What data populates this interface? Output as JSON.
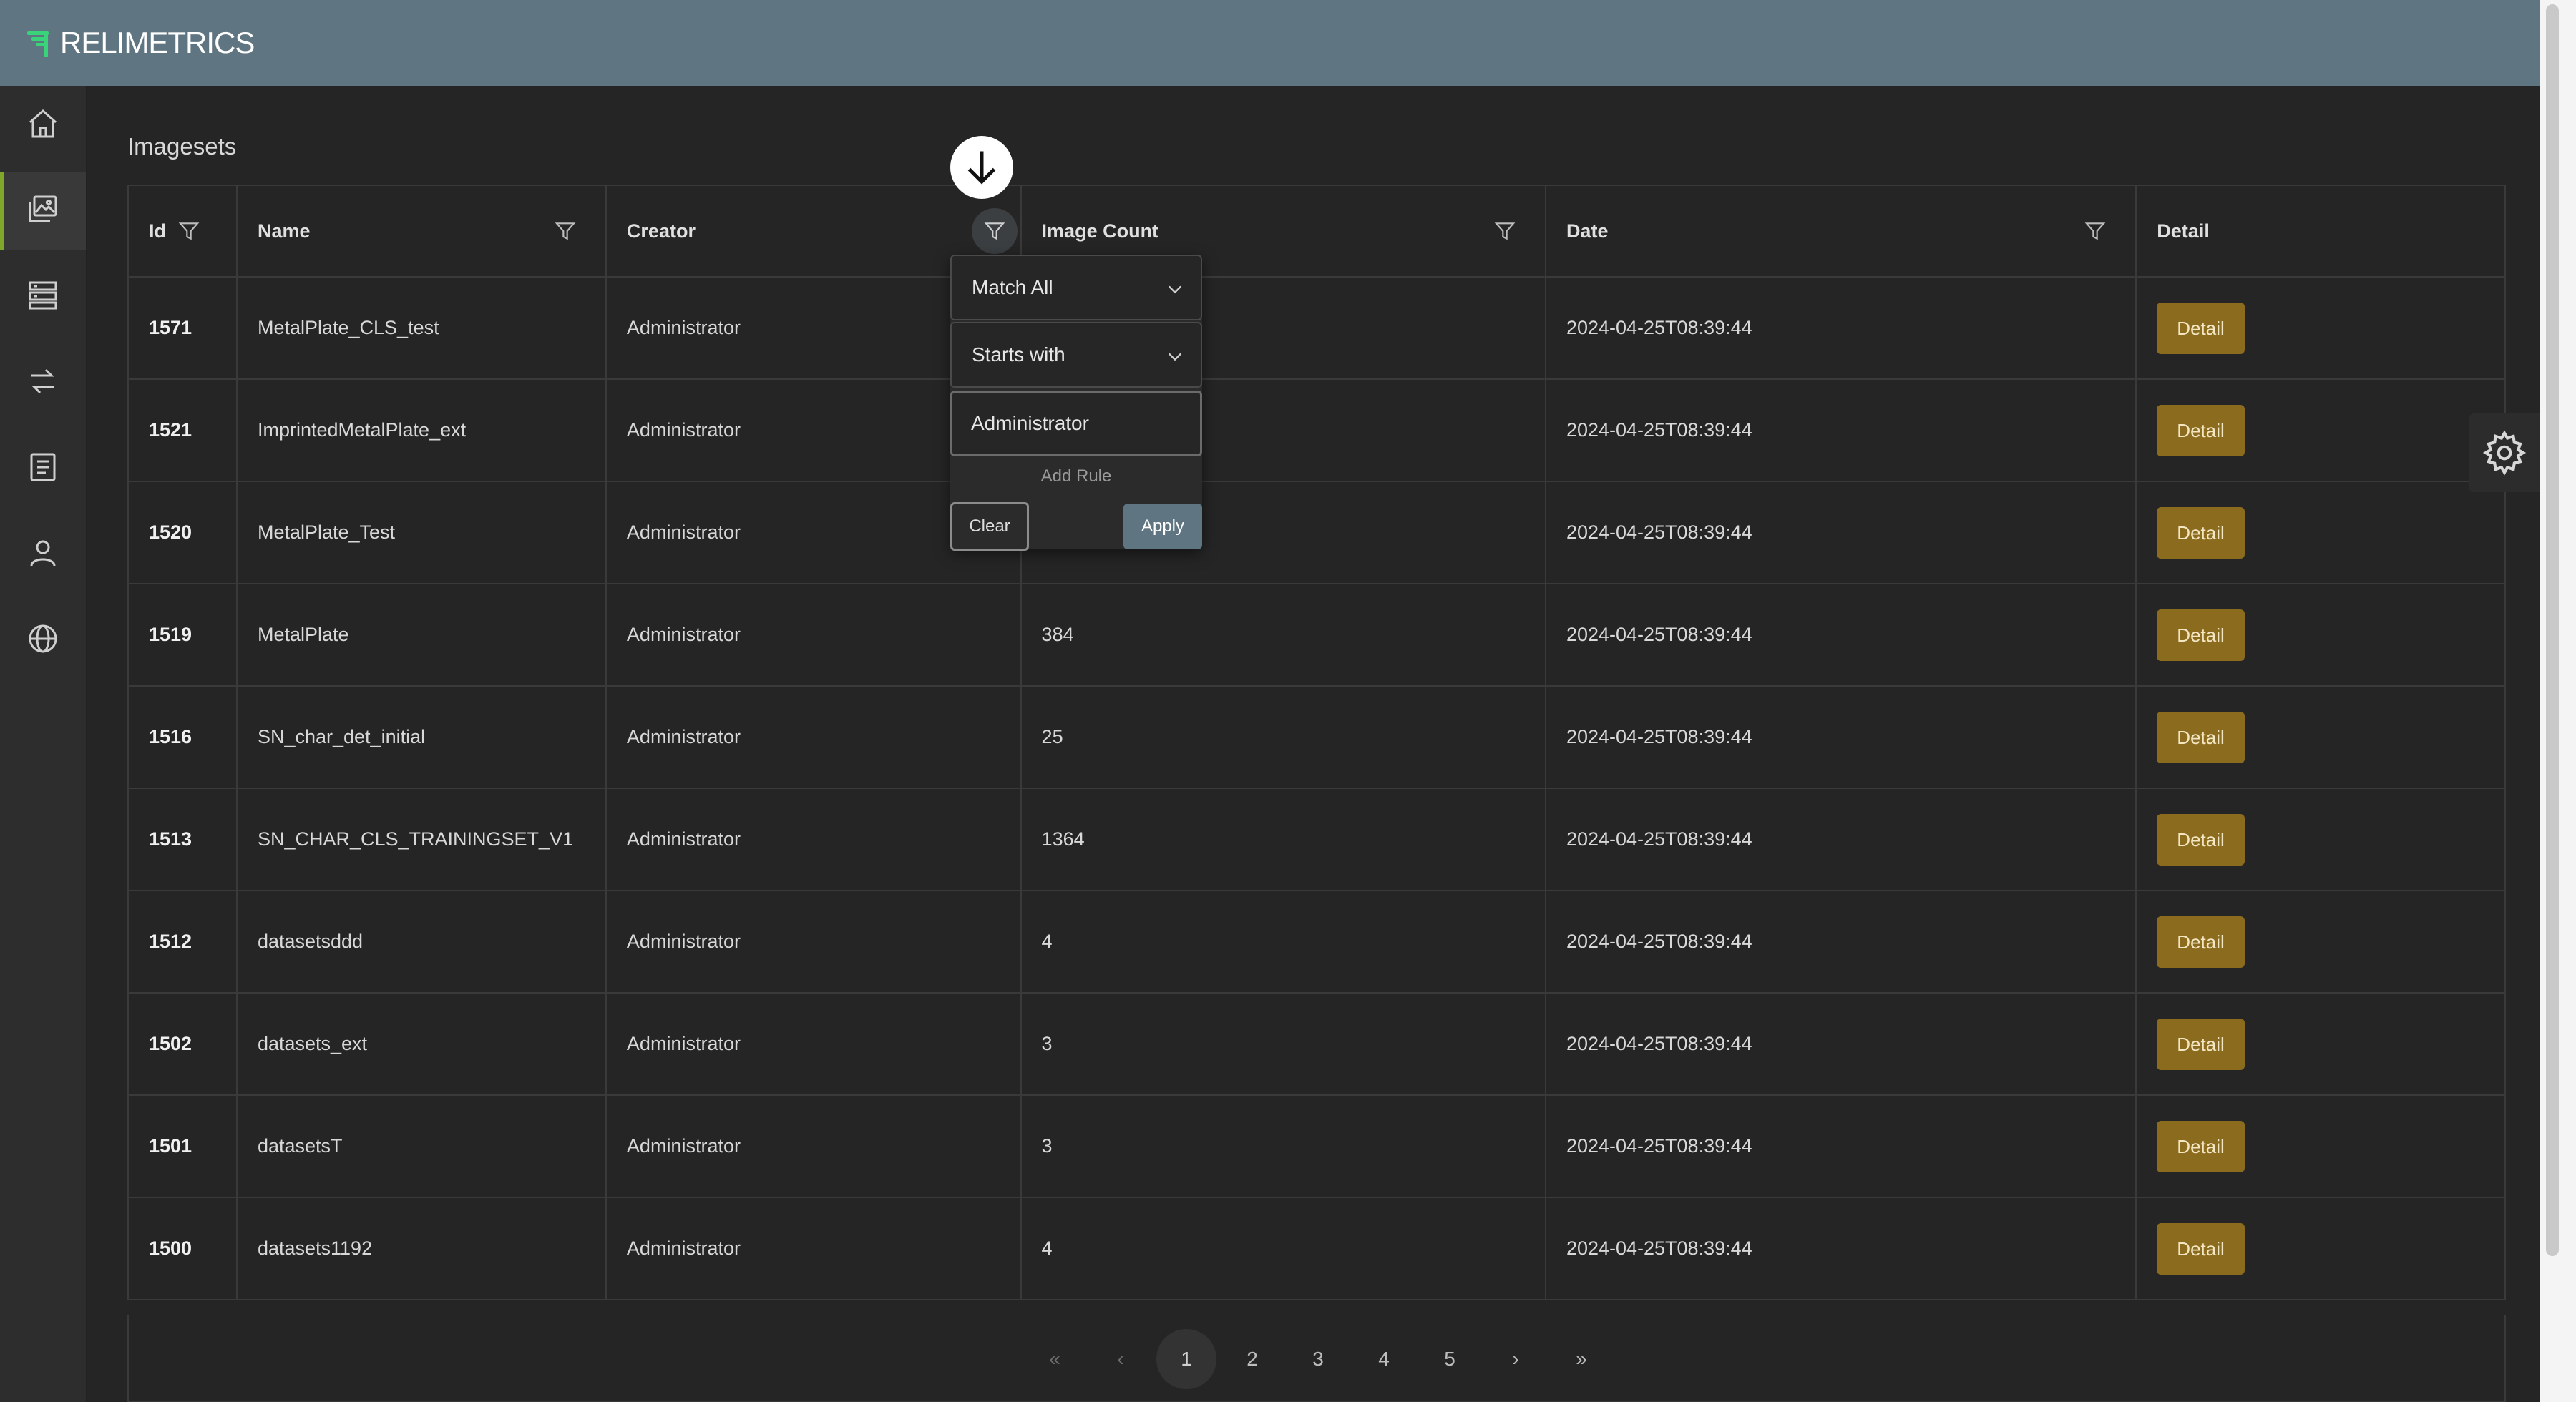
{
  "app": {
    "logo_text": "RELIMETRICS"
  },
  "sidebar": {
    "items": [
      {
        "icon": "home-icon"
      },
      {
        "icon": "images-icon",
        "active": true
      },
      {
        "icon": "server-icon"
      },
      {
        "icon": "arrows-icon"
      },
      {
        "icon": "document-icon"
      },
      {
        "icon": "user-icon"
      },
      {
        "icon": "globe-icon"
      }
    ]
  },
  "page": {
    "title": "Imagesets"
  },
  "table": {
    "columns": {
      "id": "Id",
      "name": "Name",
      "creator": "Creator",
      "image_count": "Image Count",
      "date": "Date",
      "detail": "Detail"
    },
    "rows": [
      {
        "id": "1571",
        "name": "MetalPlate_CLS_test",
        "creator": "Administrator",
        "image_count": "",
        "date": "2024-04-25T08:39:44",
        "detail": "Detail"
      },
      {
        "id": "1521",
        "name": "ImprintedMetalPlate_ext",
        "creator": "Administrator",
        "image_count": "",
        "date": "2024-04-25T08:39:44",
        "detail": "Detail"
      },
      {
        "id": "1520",
        "name": "MetalPlate_Test",
        "creator": "Administrator",
        "image_count": "",
        "date": "2024-04-25T08:39:44",
        "detail": "Detail"
      },
      {
        "id": "1519",
        "name": "MetalPlate",
        "creator": "Administrator",
        "image_count": "384",
        "date": "2024-04-25T08:39:44",
        "detail": "Detail"
      },
      {
        "id": "1516",
        "name": "SN_char_det_initial",
        "creator": "Administrator",
        "image_count": "25",
        "date": "2024-04-25T08:39:44",
        "detail": "Detail"
      },
      {
        "id": "1513",
        "name": "SN_CHAR_CLS_TRAININGSET_V1",
        "creator": "Administrator",
        "image_count": "1364",
        "date": "2024-04-25T08:39:44",
        "detail": "Detail"
      },
      {
        "id": "1512",
        "name": "datasetsddd",
        "creator": "Administrator",
        "image_count": "4",
        "date": "2024-04-25T08:39:44",
        "detail": "Detail"
      },
      {
        "id": "1502",
        "name": "datasets_ext",
        "creator": "Administrator",
        "image_count": "3",
        "date": "2024-04-25T08:39:44",
        "detail": "Detail"
      },
      {
        "id": "1501",
        "name": "datasetsT",
        "creator": "Administrator",
        "image_count": "3",
        "date": "2024-04-25T08:39:44",
        "detail": "Detail"
      },
      {
        "id": "1500",
        "name": "datasets1192",
        "creator": "Administrator",
        "image_count": "4",
        "date": "2024-04-25T08:39:44",
        "detail": "Detail"
      }
    ]
  },
  "filter": {
    "match_mode": "Match All",
    "operator": "Starts with",
    "value": "Administrator",
    "add_rule": "Add Rule",
    "clear": "Clear",
    "apply": "Apply"
  },
  "pagination": {
    "first": "«",
    "prev": "‹",
    "pages": [
      "1",
      "2",
      "3",
      "4",
      "5"
    ],
    "current": "1",
    "next": "›",
    "last": "»"
  },
  "colors": {
    "header": "#5f7581",
    "accent": "#7fa82b",
    "detail_button": "#8b6b1e",
    "logo_mark": "#39d37a"
  }
}
